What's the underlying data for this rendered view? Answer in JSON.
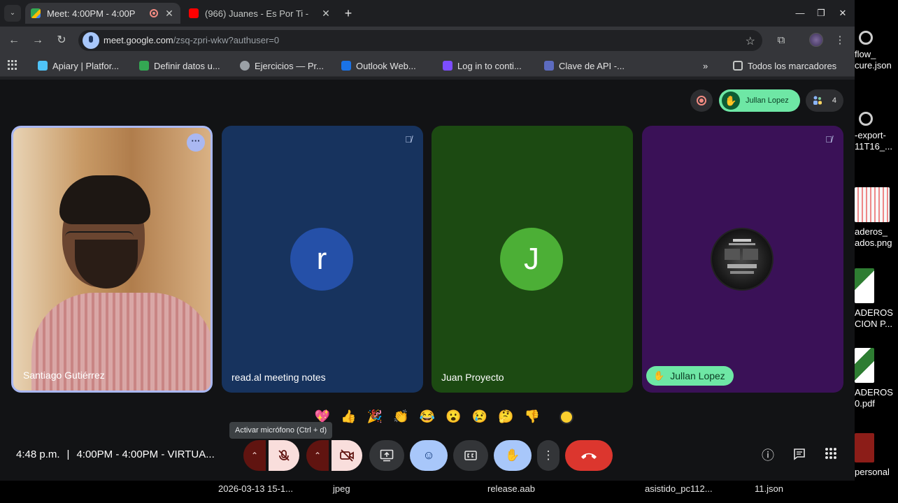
{
  "browser": {
    "tabs": [
      {
        "label": "Meet: 4:00PM - 4:00P",
        "close": "✕",
        "favicon_color": "#34a853"
      },
      {
        "label": "(966) Juanes - Es Por Ti -",
        "close": "✕",
        "favicon_color": "#ff0000"
      }
    ],
    "new_tab": "+",
    "window_controls": {
      "minimize": "—",
      "maximize": "❐",
      "close": "✕"
    },
    "url_host": "meet.google.com",
    "url_path": "/zsq-zpri-wkw?authuser=0",
    "bookmarks": [
      {
        "label": "Apiary | Platfor...",
        "color": "#4fc3f7"
      },
      {
        "label": "Definir datos u...",
        "color": "#34a853"
      },
      {
        "label": "Ejercicios — Pr...",
        "color": "#9aa0a6"
      },
      {
        "label": "Outlook Web...",
        "color": "#1a73e8"
      },
      {
        "label": "Log in to conti...",
        "color": "#7c4dff"
      },
      {
        "label": "Clave de API -...",
        "color": "#5c6bc0"
      }
    ],
    "bookmarks_overflow": "»",
    "all_bookmarks": "Todos los marcadores"
  },
  "meet": {
    "hand_raised_name": "Jullan Lopez",
    "participant_count": "4",
    "participants": [
      {
        "name": "Santiago Gutiérrez"
      },
      {
        "name": "read.al meeting notes",
        "initial": "r",
        "avatar_color": "#2550a8"
      },
      {
        "name": "Juan Proyecto",
        "initial": "J",
        "avatar_color": "#4caf36"
      },
      {
        "name": "Jullan Lopez"
      }
    ],
    "reactions": [
      "💖",
      "👍",
      "🎉",
      "👏",
      "😂",
      "😮",
      "😢",
      "🤔",
      "👎"
    ],
    "tooltip": "Activar micrófono (Ctrl + d)",
    "time": "4:48 p.m.",
    "separator": "|",
    "meeting_title": "4:00PM - 4:00PM - VIRTUA...",
    "colors": {
      "end_call": "#dc362e",
      "muted": "#f9dedc",
      "active_blue": "#a8c7fa",
      "hand_green": "#6ee7a5"
    }
  },
  "desktop": {
    "files": [
      {
        "label": "flow_"
      },
      {
        "label": "cure.json"
      },
      {
        "label": "-export-"
      },
      {
        "label": "11T16_..."
      },
      {
        "label": "aderos_"
      },
      {
        "label": "ados.png"
      },
      {
        "label": "ADEROS"
      },
      {
        "label": "CION P..."
      },
      {
        "label": "ADEROS"
      },
      {
        "label": "0.pdf"
      },
      {
        "label": "personal"
      }
    ],
    "taskbar": [
      "2026-03-13 15-1...",
      "jpeg",
      "release.aab",
      "asistido_pc112...",
      "11.json"
    ]
  }
}
